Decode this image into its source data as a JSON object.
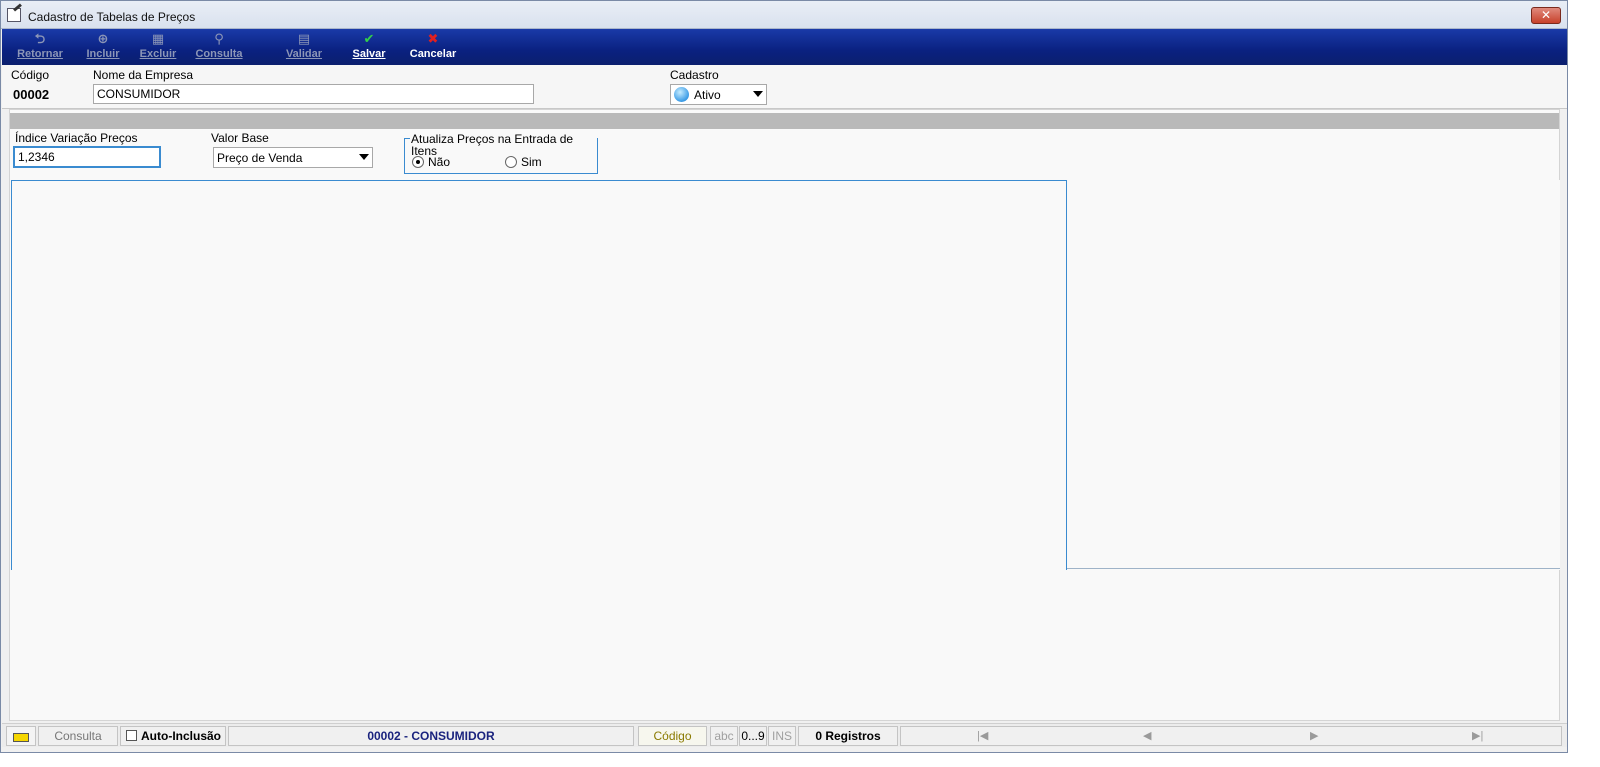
{
  "window": {
    "title": "Cadastro de Tabelas de Preços",
    "close_label": "✕"
  },
  "toolbar": {
    "buttons": [
      {
        "label": "Retornar",
        "icon": "undo-arrow-icon",
        "glyph": "⮌",
        "enabled": false
      },
      {
        "label": "Incluir",
        "icon": "plus-circle-icon",
        "glyph": "⊕",
        "enabled": false
      },
      {
        "label": "Excluir",
        "icon": "trash-icon",
        "glyph": "▦",
        "enabled": false
      },
      {
        "label": "Consulta",
        "icon": "magnifier-icon",
        "glyph": "⚲",
        "enabled": false
      },
      {
        "label": "Validar",
        "icon": "validate-grid-icon",
        "glyph": "▤",
        "enabled": false
      },
      {
        "label": "Salvar",
        "icon": "checkmark-icon",
        "glyph": "✔",
        "enabled": true
      },
      {
        "label": "Cancelar",
        "icon": "x-icon",
        "glyph": "✖",
        "enabled": true
      }
    ]
  },
  "header": {
    "codigo_label": "Código",
    "codigo_value": "00002",
    "empresa_label": "Nome da Empresa",
    "empresa_value": "CONSUMIDOR",
    "cadastro_label": "Cadastro",
    "cadastro_value": "Ativo"
  },
  "form": {
    "indice_label": "Índice Variação Preços",
    "indice_value": "1,2346",
    "valor_base_label": "Valor Base",
    "valor_base_value": "Preço de Venda",
    "atualiza_group_title": "Atualiza Preços na Entrada de Itens",
    "options": [
      {
        "label": "Não",
        "checked": true
      },
      {
        "label": "Sim",
        "checked": false
      }
    ]
  },
  "statusbar": {
    "mode": "Consulta",
    "auto_inclusao": "Auto-Inclusão",
    "current_record": "00002 - CONSUMIDOR",
    "sort_field": "Código",
    "abc": "abc",
    "digits": "0...9",
    "ins": "INS",
    "registros": "0 Registros",
    "nav_first": "|◀",
    "nav_prev": "◀",
    "nav_next": "▶",
    "nav_last": "▶|"
  },
  "colors": {
    "toolbar_blue": "#0a2180",
    "focus_border": "#3a8bd0",
    "status_record_text": "#1a237e",
    "sort_field_text": "#8a7a00"
  }
}
